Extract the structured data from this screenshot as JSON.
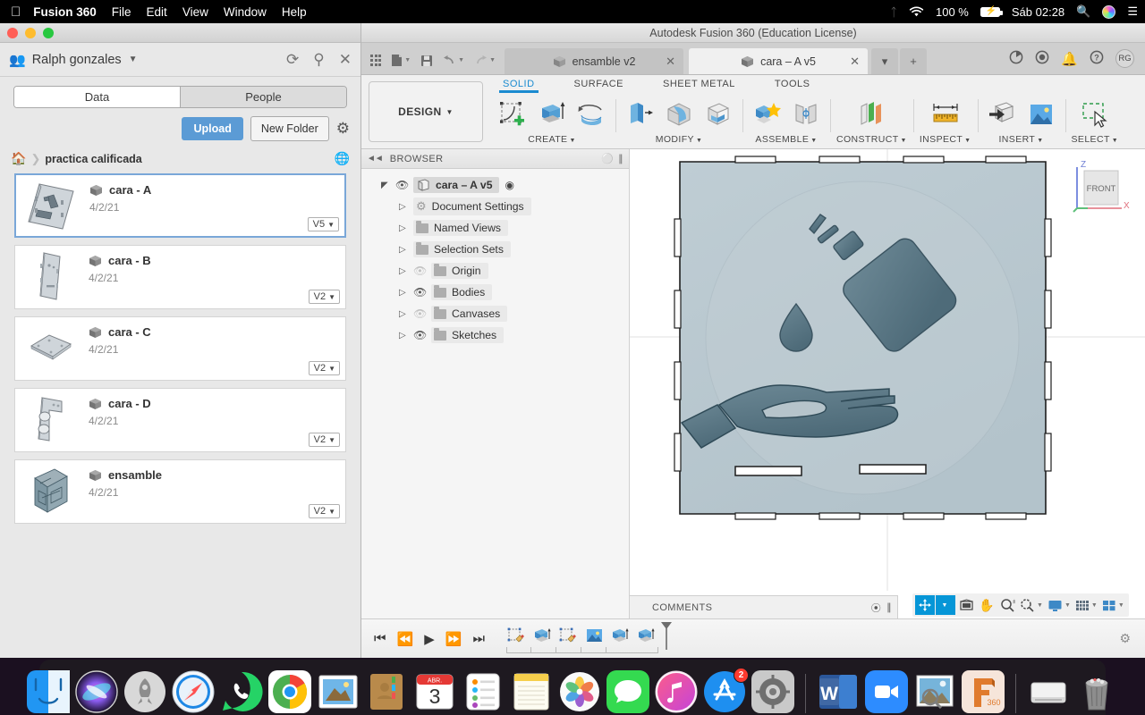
{
  "menubar": {
    "apple_icon": "apple-icon",
    "app_name": "Fusion 360",
    "items": [
      "File",
      "Edit",
      "View",
      "Window",
      "Help"
    ],
    "bluetooth_icon": "bluetooth-icon",
    "wifi_icon": "wifi-icon",
    "battery_percent": "100 %",
    "clock": "Sáb 02:28",
    "search_icon": "spotlight-search-icon",
    "siri_icon": "siri-icon",
    "control_center_icon": "control-center-icon"
  },
  "data_panel": {
    "user_name": "Ralph gonzales",
    "group_icon": "people-group-icon",
    "refresh_icon": "refresh-icon",
    "search_icon": "search-icon",
    "close_icon": "close-icon",
    "tabs": [
      {
        "label": "Data",
        "active": true
      },
      {
        "label": "People",
        "active": false
      }
    ],
    "upload_label": "Upload",
    "new_folder_label": "New Folder",
    "settings_icon": "gear-icon",
    "breadcrumb": {
      "home_icon": "home-icon",
      "current": "practica calificada",
      "globe_icon": "globe-icon"
    },
    "files": [
      {
        "name": "cara - A",
        "date": "4/2/21",
        "version": "V5",
        "selected": true,
        "thumb": "thumb-cara-a"
      },
      {
        "name": "cara - B",
        "date": "4/2/21",
        "version": "V2",
        "selected": false,
        "thumb": "thumb-cara-b"
      },
      {
        "name": "cara - C",
        "date": "4/2/21",
        "version": "V2",
        "selected": false,
        "thumb": "thumb-cara-c"
      },
      {
        "name": "cara - D",
        "date": "4/2/21",
        "version": "V2",
        "selected": false,
        "thumb": "thumb-cara-d"
      },
      {
        "name": "ensamble",
        "date": "4/2/21",
        "version": "V2",
        "selected": false,
        "thumb": "thumb-ensamble"
      }
    ]
  },
  "fusion": {
    "window_title": "Autodesk Fusion 360 (Education License)",
    "quick_access": [
      "app-grid-icon",
      "new-document-icon",
      "save-icon",
      "undo-icon",
      "redo-icon"
    ],
    "document_tabs": [
      {
        "label": "ensamble v2",
        "active": false
      },
      {
        "label": "cara – A v5",
        "active": true
      }
    ],
    "tab_controls": [
      "chevron-down-icon",
      "plus-icon"
    ],
    "header_icons": [
      "job-status-icon",
      "recent-icon",
      "notifications-icon",
      "help-icon"
    ],
    "avatar_initials": "RG",
    "workspace_label": "DESIGN",
    "ribbon_tabs": [
      {
        "label": "SOLID",
        "active": true
      },
      {
        "label": "SURFACE",
        "active": false
      },
      {
        "label": "SHEET METAL",
        "active": false
      },
      {
        "label": "TOOLS",
        "active": false
      }
    ],
    "ribbon_groups": [
      {
        "label": "CREATE",
        "icons": [
          "create-sketch-icon",
          "extrude-icon",
          "revolve-icon"
        ]
      },
      {
        "label": "MODIFY",
        "icons": [
          "press-pull-icon",
          "fillet-icon",
          "shell-icon"
        ]
      },
      {
        "label": "ASSEMBLE",
        "icons": [
          "new-component-icon",
          "joint-icon"
        ]
      },
      {
        "label": "CONSTRUCT",
        "icons": [
          "offset-plane-icon"
        ]
      },
      {
        "label": "INSPECT",
        "icons": [
          "measure-icon"
        ]
      },
      {
        "label": "INSERT",
        "icons": [
          "insert-derive-icon",
          "insert-canvas-icon"
        ]
      },
      {
        "label": "SELECT",
        "icons": [
          "select-window-icon"
        ]
      }
    ],
    "browser": {
      "title": "BROWSER",
      "collapse_icon": "collapse-left-icon",
      "minimize_icon": "minimize-icon",
      "nodes": [
        {
          "label": "cara – A v5",
          "indent": 0,
          "eye": "on",
          "icon": "component-icon",
          "root": true
        },
        {
          "label": "Document Settings",
          "indent": 1,
          "eye": "none",
          "icon": "gear-icon"
        },
        {
          "label": "Named Views",
          "indent": 1,
          "eye": "none",
          "icon": "folder-icon"
        },
        {
          "label": "Selection Sets",
          "indent": 1,
          "eye": "none",
          "icon": "folder-icon"
        },
        {
          "label": "Origin",
          "indent": 1,
          "eye": "off",
          "icon": "folder-icon"
        },
        {
          "label": "Bodies",
          "indent": 1,
          "eye": "on",
          "icon": "folder-icon"
        },
        {
          "label": "Canvases",
          "indent": 1,
          "eye": "off",
          "icon": "folder-icon"
        },
        {
          "label": "Sketches",
          "indent": 1,
          "eye": "on",
          "icon": "folder-icon"
        }
      ]
    },
    "viewcube": {
      "face_label": "FRONT",
      "axis_z": "Z",
      "axis_x": "X"
    },
    "comments": {
      "label": "COMMENTS",
      "add_icon": "add-comment-icon"
    },
    "nav_toolbar": [
      {
        "icon": "orbit-icon",
        "active": true,
        "caret": true
      },
      {
        "icon": "look-at-icon",
        "active": false,
        "caret": false
      },
      {
        "icon": "pan-icon",
        "active": false,
        "caret": false
      },
      {
        "icon": "zoom-icon",
        "active": false,
        "caret": false
      },
      {
        "icon": "zoom-window-icon",
        "active": false,
        "caret": true
      },
      {
        "icon": "display-settings-icon",
        "active": false,
        "caret": true
      },
      {
        "icon": "grid-snaps-icon",
        "active": false,
        "caret": true
      },
      {
        "icon": "viewports-icon",
        "active": false,
        "caret": true
      }
    ],
    "timeline": {
      "playback_icons": [
        "skip-start-icon",
        "step-back-icon",
        "play-icon",
        "step-forward-icon",
        "skip-end-icon"
      ],
      "features": [
        "sketch-feature-icon",
        "extrude-feature-icon",
        "sketch-feature-icon",
        "canvas-feature-icon",
        "extrude-feature-icon",
        "extrude-feature-icon"
      ],
      "settings_icon": "gear-icon"
    },
    "canvas": {
      "model_name": "hand-sanitizer-panel-sketch"
    }
  },
  "dock": {
    "items": [
      {
        "name": "finder",
        "running": true
      },
      {
        "name": "siri",
        "running": false
      },
      {
        "name": "launchpad",
        "running": false
      },
      {
        "name": "safari",
        "running": false
      },
      {
        "name": "whatsapp",
        "running": false
      },
      {
        "name": "google-chrome",
        "running": true
      },
      {
        "name": "mail",
        "running": false
      },
      {
        "name": "contacts",
        "running": false
      },
      {
        "name": "calendar",
        "running": false,
        "month": "ABR.",
        "day": "3"
      },
      {
        "name": "reminders",
        "running": false
      },
      {
        "name": "notes",
        "running": false
      },
      {
        "name": "photos",
        "running": false
      },
      {
        "name": "messages",
        "running": false
      },
      {
        "name": "music",
        "running": false
      },
      {
        "name": "app-store",
        "running": false,
        "badge": "2"
      },
      {
        "name": "system-preferences",
        "running": false
      },
      {
        "name": "microsoft-word",
        "running": false
      },
      {
        "name": "zoom",
        "running": true
      },
      {
        "name": "preview",
        "running": true
      },
      {
        "name": "fusion-360",
        "running": true
      },
      {
        "name": "disk-drive",
        "running": false
      },
      {
        "name": "trash",
        "running": false
      }
    ]
  }
}
